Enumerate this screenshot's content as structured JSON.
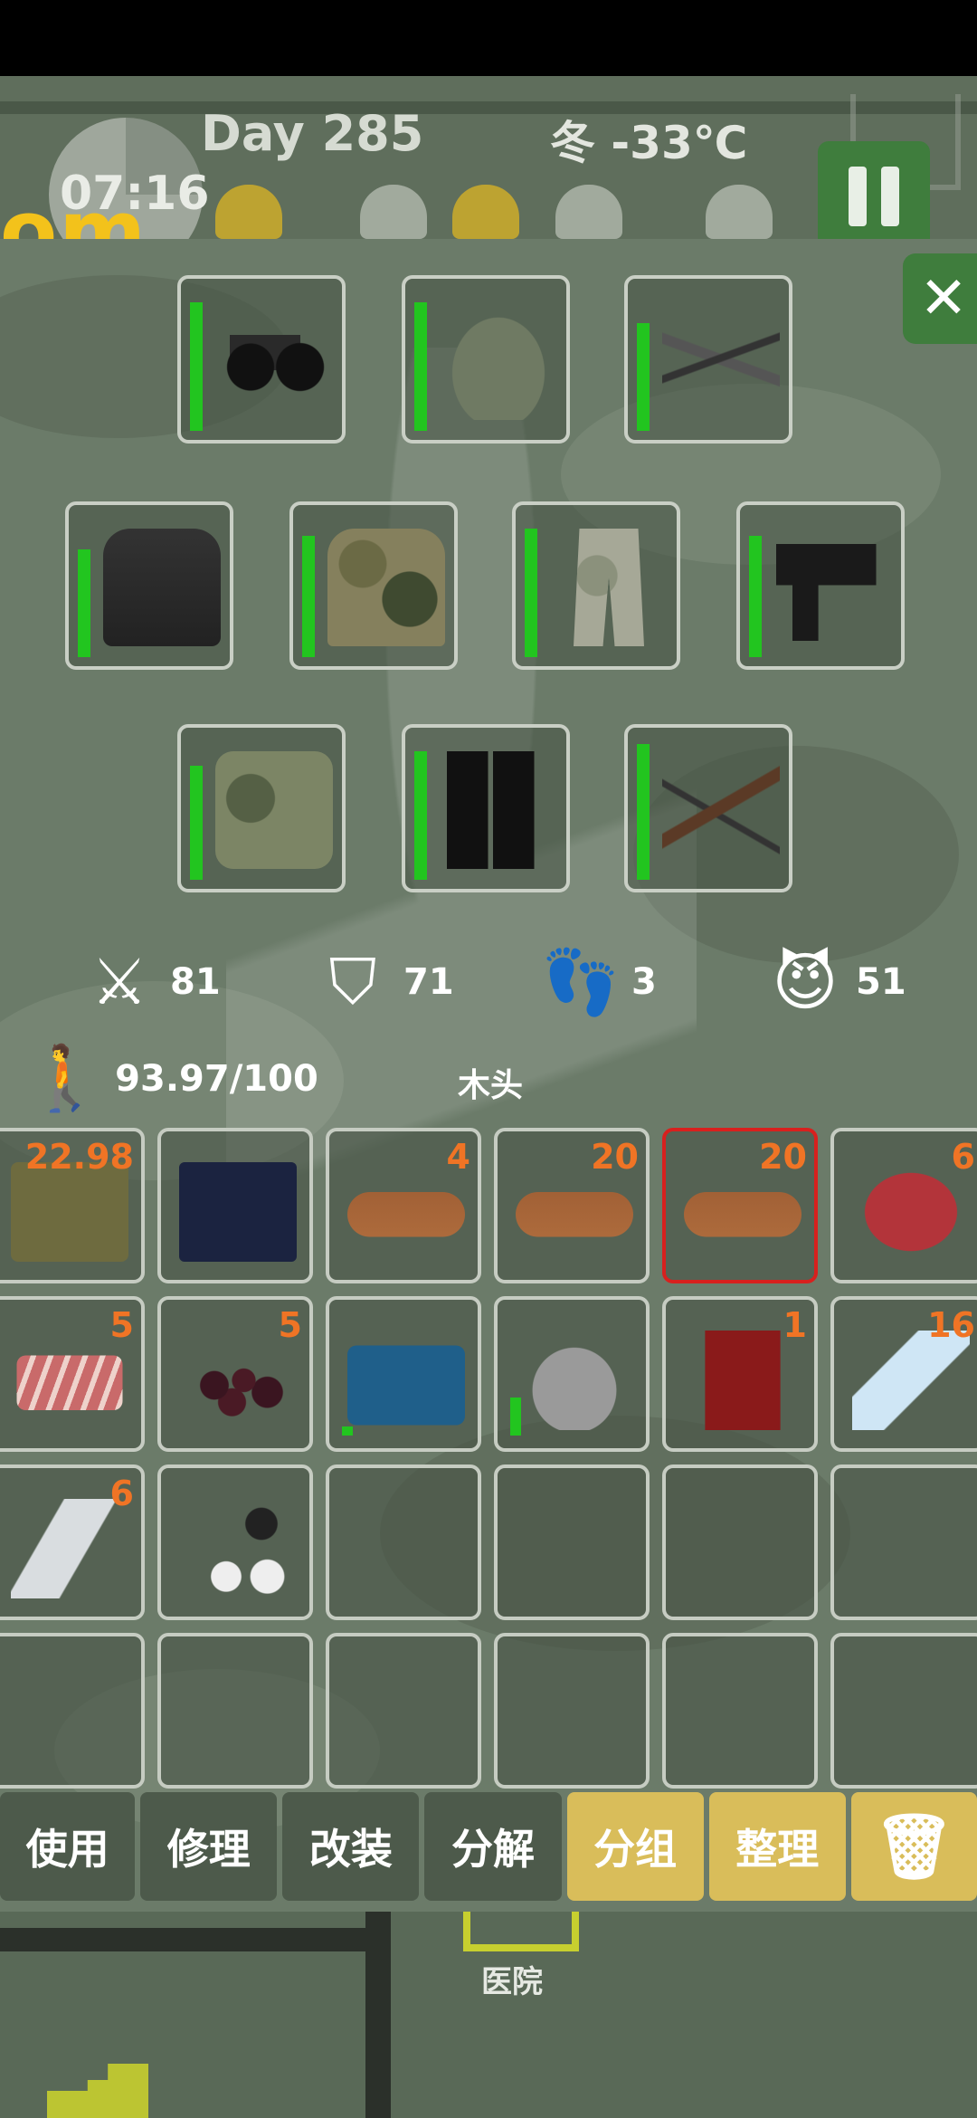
{
  "hud": {
    "day": "Day 285",
    "season_temp": "冬 -33℃",
    "clock": "07:16",
    "logo": "om"
  },
  "equipment": [
    {
      "name": "binoculars",
      "durability": 0.9
    },
    {
      "name": "combat-helmet",
      "durability": 0.9
    },
    {
      "name": "sword-and-knife",
      "durability": 0.75
    },
    {
      "name": "body-armor",
      "durability": 0.75
    },
    {
      "name": "camo-jacket",
      "durability": 0.85
    },
    {
      "name": "camo-pants",
      "durability": 0.9
    },
    {
      "name": "pistol",
      "durability": 0.85
    },
    {
      "name": "camo-backpack",
      "durability": 0.8
    },
    {
      "name": "combat-boots",
      "durability": 0.9
    },
    {
      "name": "crossbow",
      "durability": 0.95
    }
  ],
  "stats": {
    "attack": "81",
    "defense": "71",
    "steps": "3",
    "mood": "51"
  },
  "carry": {
    "weight": "93.97/100",
    "selected_item": "木头"
  },
  "inventory": [
    {
      "name": "fuel-canister",
      "count": "22.98"
    },
    {
      "name": "passport",
      "count": ""
    },
    {
      "name": "wood-log",
      "count": "4"
    },
    {
      "name": "wood-log",
      "count": "20"
    },
    {
      "name": "wood-log",
      "count": "20",
      "selected": true
    },
    {
      "name": "raw-steak",
      "count": "6"
    },
    {
      "name": "raw-ribs",
      "count": "5"
    },
    {
      "name": "wild-berries",
      "count": "5"
    },
    {
      "name": "toolbox",
      "count": "",
      "durability": 0.05
    },
    {
      "name": "cooking-pot",
      "count": "",
      "durability": 0.3
    },
    {
      "name": "coffee-pack",
      "count": "1"
    },
    {
      "name": "water-bottle",
      "count": "16"
    },
    {
      "name": "water-bottle-partial",
      "count": "6"
    },
    {
      "name": "motorcycle-key",
      "count": ""
    }
  ],
  "actions": {
    "use": "使用",
    "repair": "修理",
    "modify": "改装",
    "dismantle": "分解",
    "group": "分组",
    "sort": "整理"
  },
  "map": {
    "hospital": "医院"
  },
  "colors": {
    "accent_gold": "#d9bd5a",
    "durability_green": "#22c51f",
    "count_orange": "#f07425",
    "selection_red": "#d8201e",
    "close_green": "#3f7d3d"
  }
}
